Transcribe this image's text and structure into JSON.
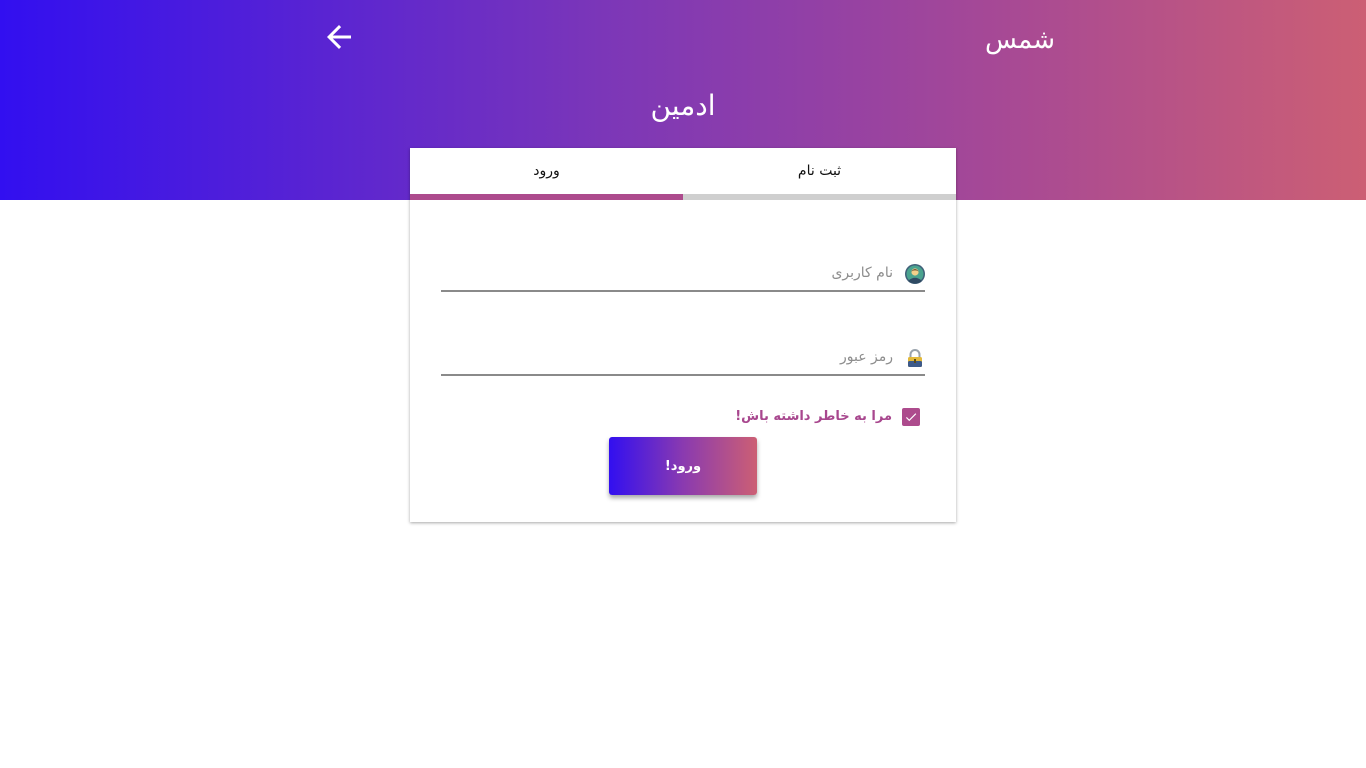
{
  "header": {
    "brand": "شمس",
    "title": "ادمین",
    "back_icon": "arrow-left-icon",
    "gradient": [
      "#320ff0",
      "#cc5f74"
    ]
  },
  "tabs": {
    "register_label": "ثبت نام",
    "login_label": "ورود",
    "active": "login"
  },
  "form": {
    "username_placeholder": "نام کاربری",
    "username_value": "",
    "username_icon": "user-avatar-icon",
    "password_placeholder": "رمز عبور",
    "password_value": "",
    "password_icon": "lock-icon",
    "remember_label": "مرا به خاطر داشته باش!",
    "remember_checked": true,
    "submit_label": "ورود!"
  },
  "colors": {
    "accent": "#ad4b8d",
    "field_line": "#8a8a8a"
  }
}
